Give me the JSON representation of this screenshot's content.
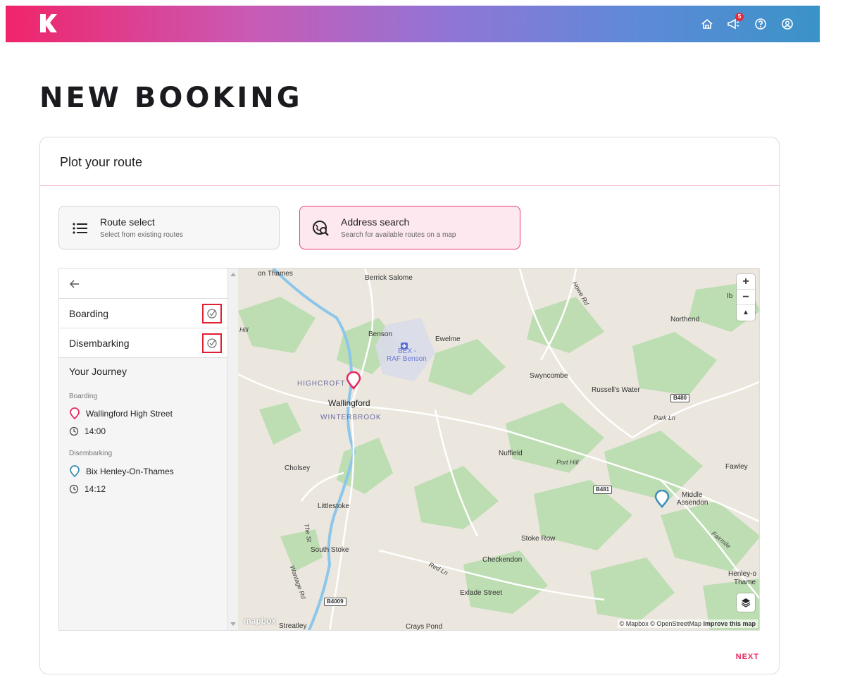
{
  "header": {
    "logo_icon": "k-logo-icon",
    "icons": [
      "home-icon",
      "megaphone-icon",
      "help-icon",
      "account-icon"
    ],
    "notification_count": "5"
  },
  "page": {
    "title": "NEW BOOKING"
  },
  "card": {
    "title": "Plot your route",
    "modes": [
      {
        "title": "Route select",
        "subtitle": "Select from existing routes",
        "icon": "list-icon",
        "active": false
      },
      {
        "title": "Address search",
        "subtitle": "Search for available routes on a map",
        "icon": "map-search-icon",
        "active": true
      }
    ],
    "next_label": "NEXT"
  },
  "sidebar": {
    "boarding_label": "Boarding",
    "disembarking_label": "Disembarking",
    "journey": {
      "title": "Your Journey",
      "boarding_heading": "Boarding",
      "boarding_stop": "Wallingford High Street",
      "boarding_time": "14:00",
      "disembarking_heading": "Disembarking",
      "disembarking_stop": "Bix Henley-On-Thames",
      "disembarking_time": "14:12"
    }
  },
  "map": {
    "places": {
      "on_thames": "on Thames",
      "berrick": "Berrick Salome",
      "benson": "Benson",
      "ewelme": "Ewelme",
      "bex": "BEX -",
      "raf": "RAF Benson",
      "highcroft": "HIGHCROFT",
      "wallingford": "Wallingford",
      "winterbrook": "WINTERBROOK",
      "swyncombe": "Swyncombe",
      "russells": "Russell's Water",
      "northend": "Northend",
      "ib": "Ib",
      "park_ln": "Park Ln",
      "nuffield": "Nuffield",
      "port_hill": "Port Hill",
      "cholsey": "Cholsey",
      "fawley": "Fawley",
      "middle": "Middle",
      "assendon": "Assendon",
      "littlestoke": "Littlestoke",
      "the_st": "The St",
      "south_stoke": "South Stoke",
      "stoke_row": "Stoke Row",
      "checkendon": "Checkendon",
      "red_ln": "Red Ln",
      "exlade": "Exlade Street",
      "wantage_rd": "Wantage Rd",
      "henley": "Henley-o",
      "thame": "Thame",
      "streatley": "Streatley",
      "crays": "Crays Pond",
      "hill": "Hill",
      "howe_rd": "Howe Rd",
      "fairmile": "Fairmile"
    },
    "shields": {
      "b480": "B480",
      "b481": "B481",
      "b4009": "B4009"
    },
    "zoom_in": "+",
    "zoom_out": "−",
    "compass": "▲",
    "logo": "mapbox",
    "attribution": "© Mapbox © OpenStreetMap",
    "improve": "Improve this map",
    "colors": {
      "boarding_pin": "#e8285f",
      "disembark_pin": "#3d8fb8"
    }
  }
}
